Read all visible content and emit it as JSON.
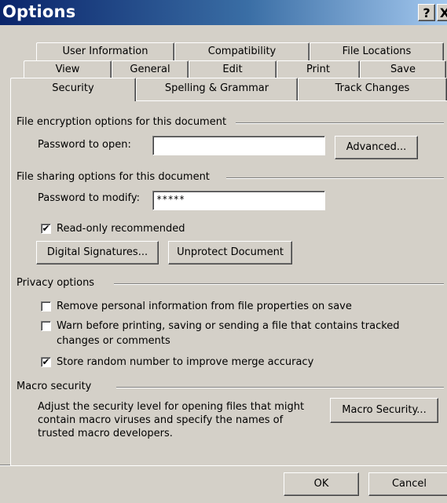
{
  "window": {
    "title": "Options",
    "help_label": "?",
    "close_label": "X"
  },
  "tabs": {
    "row1": [
      "User Information",
      "Compatibility",
      "File Locations"
    ],
    "row2": [
      "View",
      "General",
      "Edit",
      "Print",
      "Save"
    ],
    "row3": [
      "Security",
      "Spelling & Grammar",
      "Track Changes"
    ],
    "active": "Security"
  },
  "encryption": {
    "group_label": "File encryption options for this document",
    "password_open_label": "Password to open:",
    "password_open_value": "",
    "advanced_label": "Advanced..."
  },
  "sharing": {
    "group_label": "File sharing options for this document",
    "password_modify_label": "Password to modify:",
    "password_modify_value": "*****",
    "readonly_label": "Read-only recommended",
    "readonly_checked": true,
    "digital_signatures_label": "Digital Signatures...",
    "unprotect_label": "Unprotect Document"
  },
  "privacy": {
    "group_label": "Privacy options",
    "remove_personal_label": "Remove personal information from file properties on save",
    "remove_personal_checked": false,
    "warn_line1": "Warn before printing, saving or sending a file that contains tracked",
    "warn_line2": "changes or comments",
    "warn_checked": false,
    "store_random_label": "Store random number to improve merge accuracy",
    "store_random_checked": true
  },
  "macro": {
    "group_label": "Macro security",
    "desc_line1": "Adjust the security level for opening files that might",
    "desc_line2": "contain macro viruses and specify the names of",
    "desc_line3": "trusted macro developers.",
    "button_label": "Macro Security..."
  },
  "footer": {
    "ok_label": "OK",
    "cancel_label": "Cancel"
  },
  "colors": {
    "title_gradient_start": "#0a246a",
    "title_gradient_end": "#a6caf0",
    "face": "#d4d0c8"
  }
}
